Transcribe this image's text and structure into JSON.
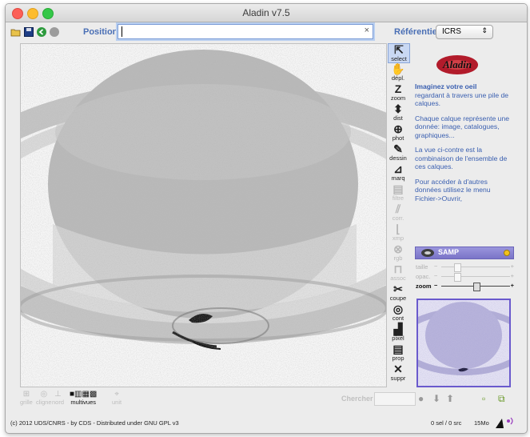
{
  "window": {
    "title": "Aladin v7.5"
  },
  "toolbar": {
    "position_label": "Position",
    "position_value": "",
    "clear_glyph": "×",
    "referentiel_label": "Référentiel",
    "referentiel_value": "ICRS",
    "icons": [
      "open-folder-icon",
      "save-icon",
      "back-icon",
      "stop-icon"
    ]
  },
  "tools": [
    {
      "label": "select",
      "glyph": "⇱",
      "icon": "cursor-arrow-icon",
      "enabled": true,
      "selected": true
    },
    {
      "label": "dépl.",
      "glyph": "✋",
      "icon": "hand-icon",
      "enabled": true
    },
    {
      "label": "zoom",
      "glyph": "Z",
      "icon": "zoom-icon",
      "enabled": true
    },
    {
      "label": "dist",
      "glyph": "⬍",
      "icon": "distance-icon",
      "enabled": true
    },
    {
      "label": "phot",
      "glyph": "⊕",
      "icon": "photometry-icon",
      "enabled": true
    },
    {
      "label": "dessin",
      "glyph": "✎",
      "icon": "pencil-icon",
      "enabled": true
    },
    {
      "label": "marq",
      "glyph": "⊿",
      "icon": "marker-icon",
      "enabled": true
    },
    {
      "label": "filtre",
      "glyph": "▤",
      "icon": "filter-icon",
      "enabled": false
    },
    {
      "label": "corr.",
      "glyph": "⫽",
      "icon": "correction-icon",
      "enabled": false
    },
    {
      "label": "xmp",
      "glyph": "⌊",
      "icon": "xmatch-icon",
      "enabled": false
    },
    {
      "label": "rgb",
      "glyph": "⊗",
      "icon": "rgb-icon",
      "enabled": false
    },
    {
      "label": "assoc",
      "glyph": "⊓",
      "icon": "assoc-icon",
      "enabled": false
    },
    {
      "label": "coupe",
      "glyph": "✂",
      "icon": "scissors-icon",
      "enabled": true
    },
    {
      "label": "cont",
      "glyph": "◎",
      "icon": "contour-icon",
      "enabled": true
    },
    {
      "label": "pixel",
      "glyph": "▟",
      "icon": "pixel-icon",
      "enabled": true
    },
    {
      "label": "prop",
      "glyph": "▤",
      "icon": "properties-icon",
      "enabled": true
    },
    {
      "label": "suppr",
      "glyph": "✕",
      "icon": "delete-icon",
      "enabled": true
    }
  ],
  "info_panel": {
    "logo_text": "Aladin",
    "heading": "Imaginez votre oeil",
    "line1": "regardant à travers une pile de calques.",
    "para2": "Chaque calque représente une donnée: image, catalogues, graphiques...",
    "para3": "La vue ci-contre est la combinaison de l'ensemble de ces calques.",
    "para4": "Pour accéder à d'autres données utilisez le menu Fichier->Ouvrir,"
  },
  "samp": {
    "label": "SAMP",
    "status_color": "#f3c21c"
  },
  "sliders": [
    {
      "name": "taille",
      "minus": "−",
      "plus": "+",
      "value": 0.2,
      "active": false
    },
    {
      "name": "opac.",
      "minus": "−",
      "plus": "+",
      "value": 0.2,
      "active": false
    },
    {
      "name": "zoom",
      "minus": "−",
      "plus": "+",
      "value": 0.5,
      "active": true
    }
  ],
  "bottom": {
    "view_modes": [
      {
        "label": "grille",
        "glyph": "⊞",
        "active": false
      },
      {
        "label": "cligne",
        "glyph": "◎",
        "active": false
      },
      {
        "label": "nord",
        "glyph": "⊥",
        "active": false
      },
      {
        "label": "multivues",
        "glyph": "■▥▦▩",
        "active": true
      },
      {
        "label": "unit",
        "glyph": "⌖",
        "active": false
      }
    ],
    "chercher_label": "Chercher",
    "chercher_value": ""
  },
  "status": {
    "copyright": "(c) 2012 UDS/CNRS - by CDS - Distributed under GNU GPL v3",
    "selection": "0 sel / 0 src",
    "memory": "15Mo"
  }
}
